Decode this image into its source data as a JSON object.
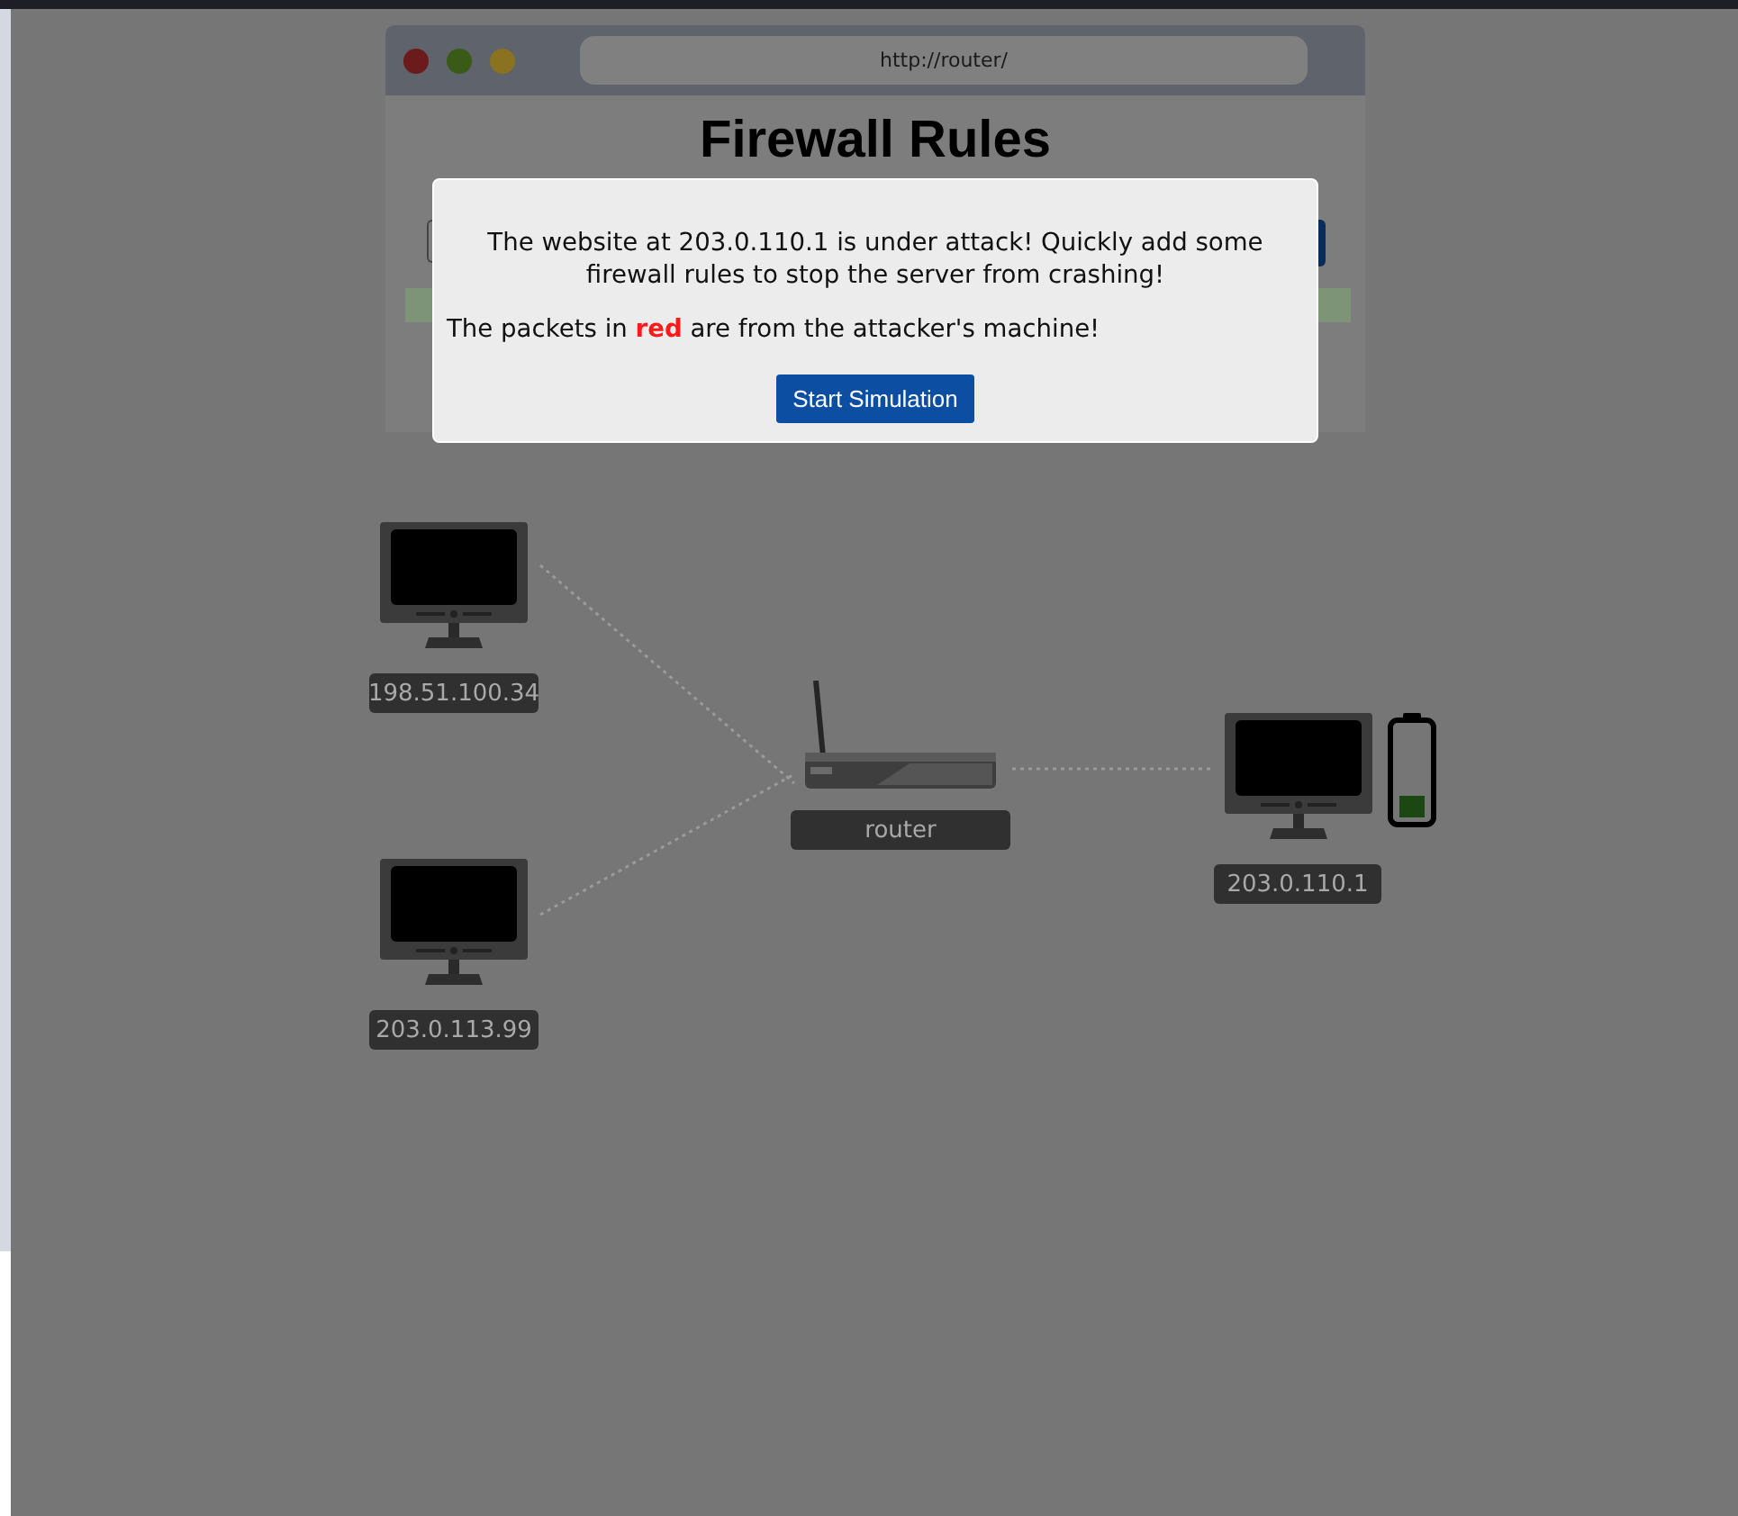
{
  "browser": {
    "url": "http://router/",
    "heading": "Firewall Rules"
  },
  "modal": {
    "paragraphs": [
      "The website at 203.0.110.1 is under attack! Quickly add some firewall rules to stop the server from crashing!",
      "The packets in **red** are from the attacker's machine!"
    ],
    "button": "Start Simulation"
  },
  "network": {
    "nodes": [
      {
        "kind": "client",
        "label": "198.51.100.34"
      },
      {
        "kind": "client",
        "label": "203.0.113.99"
      },
      {
        "kind": "router",
        "label": "router"
      },
      {
        "kind": "server",
        "label": "203.0.110.1"
      }
    ]
  }
}
